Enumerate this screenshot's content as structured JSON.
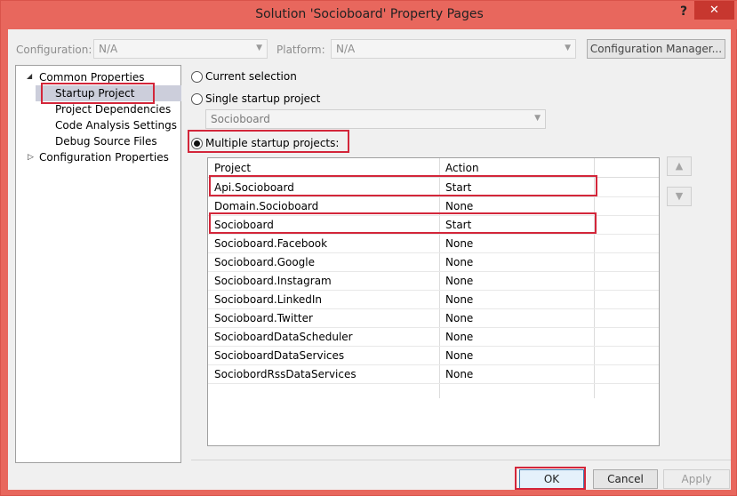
{
  "window": {
    "title": "Solution 'Socioboard' Property Pages",
    "help": "?",
    "close": "✕"
  },
  "config": {
    "configuration_label": "Configuration:",
    "configuration_value": "N/A",
    "platform_label": "Platform:",
    "platform_value": "N/A",
    "manager_button": "Configuration Manager..."
  },
  "tree": {
    "common_properties": "Common Properties",
    "startup_project": "Startup Project",
    "project_dependencies": "Project Dependencies",
    "code_analysis": "Code Analysis Settings",
    "debug_source": "Debug Source Files",
    "configuration_properties": "Configuration Properties"
  },
  "options": {
    "current_selection": "Current selection",
    "single_startup": "Single startup project",
    "single_value": "Socioboard",
    "multiple_startup": "Multiple startup projects:"
  },
  "grid": {
    "headers": [
      "Project",
      "Action"
    ],
    "rows": [
      {
        "project": "Api.Socioboard",
        "action": "Start"
      },
      {
        "project": "Domain.Socioboard",
        "action": "None"
      },
      {
        "project": "Socioboard",
        "action": "Start"
      },
      {
        "project": "Socioboard.Facebook",
        "action": "None"
      },
      {
        "project": "Socioboard.Google",
        "action": "None"
      },
      {
        "project": "Socioboard.Instagram",
        "action": "None"
      },
      {
        "project": "Socioboard.LinkedIn",
        "action": "None"
      },
      {
        "project": "Socioboard.Twitter",
        "action": "None"
      },
      {
        "project": "SocioboardDataScheduler",
        "action": "None"
      },
      {
        "project": "SocioboardDataServices",
        "action": "None"
      },
      {
        "project": "SociobordRssDataServices",
        "action": "None"
      }
    ]
  },
  "buttons": {
    "ok": "OK",
    "cancel": "Cancel",
    "apply": "Apply"
  },
  "colors": {
    "title_bar": "#e8675d",
    "highlight": "#d3263a"
  }
}
